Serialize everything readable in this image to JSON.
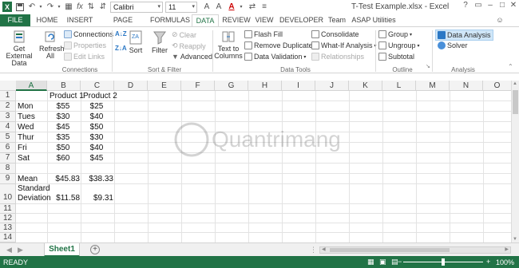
{
  "app": {
    "window_title": "T-Test Example.xlsx - Excel"
  },
  "qat": {
    "font_name": "Calibri",
    "font_size": "11"
  },
  "tabs": [
    {
      "label": "FILE"
    },
    {
      "label": "HOME"
    },
    {
      "label": "INSERT"
    },
    {
      "label": "PAGE LAYOUT"
    },
    {
      "label": "FORMULAS"
    },
    {
      "label": "DATA"
    },
    {
      "label": "REVIEW"
    },
    {
      "label": "VIEW"
    },
    {
      "label": "DEVELOPER"
    },
    {
      "label": "Team"
    },
    {
      "label": "ASAP Utilities"
    }
  ],
  "ribbon": {
    "get_external_data": "Get External Data",
    "refresh_all": "Refresh All",
    "connections": "Connections",
    "properties": "Properties",
    "edit_links": "Edit Links",
    "group_connections": "Connections",
    "sort": "Sort",
    "filter": "Filter",
    "clear": "Clear",
    "reapply": "Reapply",
    "advanced": "Advanced",
    "group_sort_filter": "Sort & Filter",
    "text_to_columns": "Text to Columns",
    "flash_fill": "Flash Fill",
    "remove_duplicates": "Remove Duplicates",
    "data_validation": "Data Validation",
    "consolidate": "Consolidate",
    "what_if": "What-If Analysis",
    "relationships": "Relationships",
    "group_data_tools": "Data Tools",
    "group": "Group",
    "ungroup": "Ungroup",
    "subtotal": "Subtotal",
    "group_outline": "Outline",
    "data_analysis": "Data Analysis",
    "solver": "Solver",
    "group_analysis": "Analysis"
  },
  "columns": [
    "A",
    "B",
    "C",
    "D",
    "E",
    "F",
    "G",
    "H",
    "I",
    "J",
    "K",
    "L",
    "M",
    "N",
    "O"
  ],
  "rows": [
    {
      "num": "1",
      "a": "",
      "b": "Product 1",
      "c": "Product 2"
    },
    {
      "num": "2",
      "a": "Mon",
      "b": "$55",
      "c": "$25"
    },
    {
      "num": "3",
      "a": "Tues",
      "b": "$30",
      "c": "$40"
    },
    {
      "num": "4",
      "a": "Wed",
      "b": "$45",
      "c": "$50"
    },
    {
      "num": "5",
      "a": "Thur",
      "b": "$35",
      "c": "$30"
    },
    {
      "num": "6",
      "a": "Fri",
      "b": "$50",
      "c": "$40"
    },
    {
      "num": "7",
      "a": "Sat",
      "b": "$60",
      "c": "$45"
    },
    {
      "num": "8",
      "a": "",
      "b": "",
      "c": ""
    },
    {
      "num": "9",
      "a": "Mean",
      "b": "$45.83",
      "c": "$38.33"
    },
    {
      "num": "10",
      "a": "Standard Deviation",
      "b": "$11.58",
      "c": "$9.31"
    },
    {
      "num": "11",
      "a": "",
      "b": "",
      "c": ""
    },
    {
      "num": "12",
      "a": "",
      "b": "",
      "c": ""
    },
    {
      "num": "13",
      "a": "",
      "b": "",
      "c": ""
    },
    {
      "num": "14",
      "a": "",
      "b": "",
      "c": ""
    }
  ],
  "sheets": {
    "active": "Sheet1"
  },
  "status": {
    "mode": "READY",
    "zoom": "100%"
  },
  "colors": {
    "accent": "#217346"
  }
}
